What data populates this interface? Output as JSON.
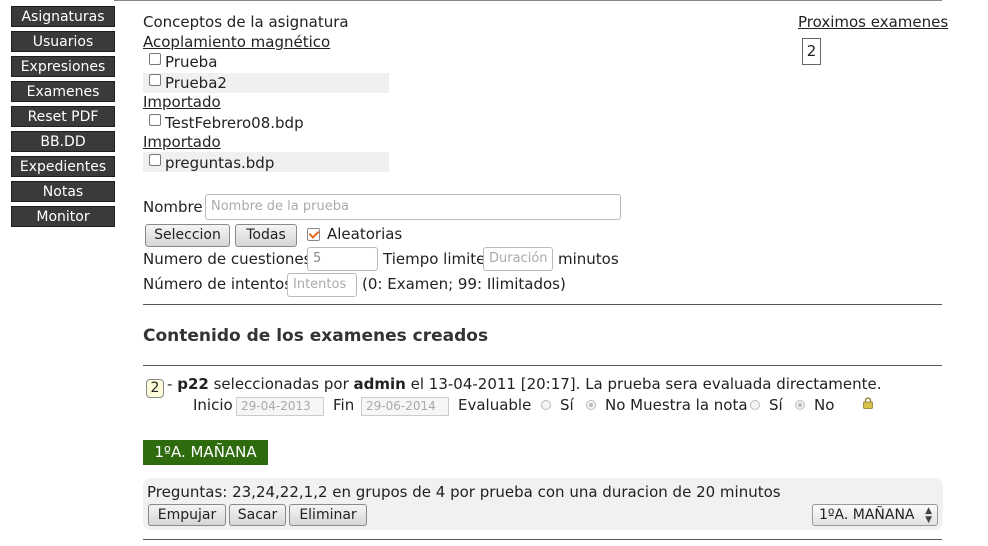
{
  "sidebar": {
    "items": [
      {
        "label": "Asignaturas"
      },
      {
        "label": "Usuarios"
      },
      {
        "label": "Expresiones"
      },
      {
        "label": "Examenes"
      },
      {
        "label": "Reset PDF"
      },
      {
        "label": "BB.DD"
      },
      {
        "label": "Expedientes"
      },
      {
        "label": "Notas"
      },
      {
        "label": "Monitor"
      }
    ]
  },
  "concepts": {
    "heading": "Conceptos de la asignatura",
    "groups": [
      {
        "title": "Acoplamiento magnético",
        "items": [
          "Prueba",
          "Prueba2"
        ]
      },
      {
        "title": "Importado",
        "items": [
          "TestFebrero08.bdp"
        ]
      },
      {
        "title": "Importado",
        "items": [
          "preguntas.bdp"
        ]
      }
    ]
  },
  "upcoming": {
    "label": "Proximos examenes",
    "count": "2"
  },
  "form": {
    "name_label": "Nombre",
    "name_placeholder": "Nombre de la prueba",
    "select_button": "Seleccion",
    "all_button": "Todas",
    "random_label": "Aleatorias",
    "random_checked": true,
    "questions_label": "Numero de cuestiones",
    "questions_value": "5",
    "time_label": "Tiempo limite",
    "time_placeholder": "Duración",
    "minutes_label": "minutos",
    "attempts_label": "Número de intentos",
    "attempts_placeholder": "Intentos",
    "attempts_hint": "(0: Examen; 99: Ilimitados)"
  },
  "created": {
    "heading": "Contenido de los examenes creados",
    "exam": {
      "badge": "2",
      "dash": "-",
      "name": "p22",
      "text1": "seleccionadas por",
      "user": "admin",
      "text2": "el 13-04-2011 [20:17]. La prueba sera evaluada directamente.",
      "start_label": "Inicio",
      "start_value": "29-04-2013",
      "end_label": "Fin",
      "end_value": "29-06-2014",
      "evaluable_label": "Evaluable",
      "yes1": "Sí",
      "no_show_label": "No Muestra la nota",
      "yes2": "Sí",
      "no2": "No"
    },
    "group_tag": "1ºA. MAÑANA",
    "questions_text": "Preguntas: 23,24,22,1,2 en grupos de 4 por prueba con una duracion de 20 minutos",
    "buttons": {
      "empujar": "Empujar",
      "sacar": "Sacar",
      "eliminar": "Eliminar"
    },
    "group_select": "1ºA. MAÑANA"
  },
  "colors": {
    "sidebar_bg": "#3a3a3a",
    "group_tag_bg": "#2e6b0f",
    "badge_bg": "#fcfcd8"
  }
}
